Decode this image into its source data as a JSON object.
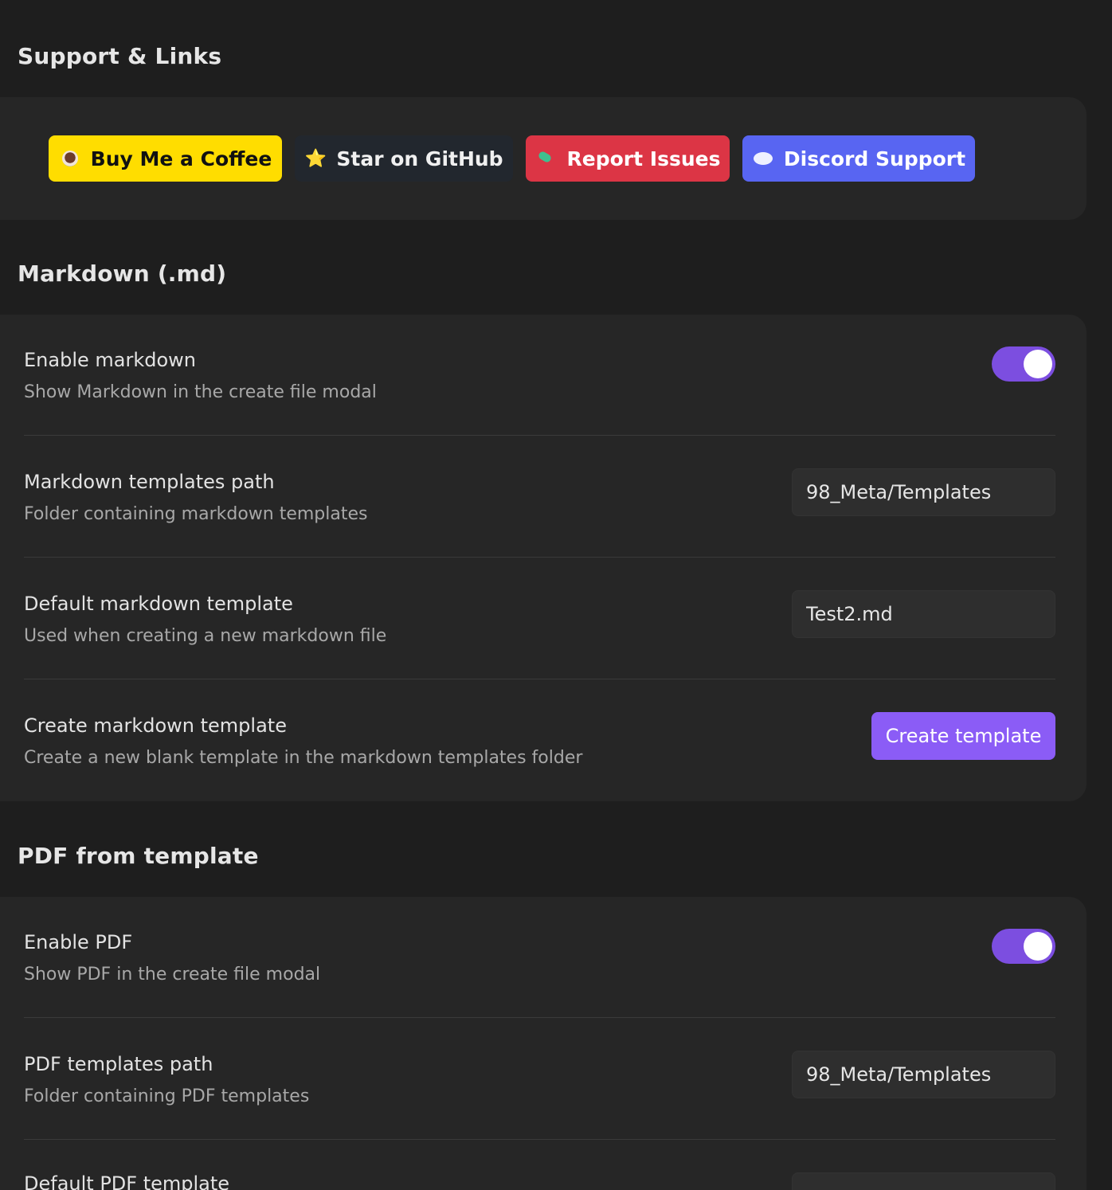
{
  "support": {
    "heading": "Support & Links",
    "buttons": {
      "coffee": {
        "label": "Buy Me a Coffee",
        "icon": "coffee-icon",
        "color": "#ffdd00"
      },
      "github": {
        "label": "Star on GitHub",
        "icon": "star-icon",
        "glyph": "⭐",
        "color": "#22272e"
      },
      "issues": {
        "label": "Report Issues",
        "icon": "bug-icon",
        "color": "#dc3545"
      },
      "discord": {
        "label": "Discord Support",
        "icon": "speech-bubble-icon",
        "color": "#5865f2"
      }
    }
  },
  "markdown": {
    "heading": "Markdown (.md)",
    "enable": {
      "name": "Enable markdown",
      "desc": "Show Markdown in the create file modal",
      "enabled": true
    },
    "templates_path": {
      "name": "Markdown templates path",
      "desc": "Folder containing markdown templates",
      "value": "98_Meta/Templates"
    },
    "default_template": {
      "name": "Default markdown template",
      "desc": "Used when creating a new markdown file",
      "value": "Test2.md"
    },
    "create_template": {
      "name": "Create markdown template",
      "desc": "Create a new blank template in the markdown templates folder",
      "button_label": "Create template"
    }
  },
  "pdf": {
    "heading": "PDF from template",
    "enable": {
      "name": "Enable PDF",
      "desc": "Show PDF in the create file modal",
      "enabled": true
    },
    "templates_path": {
      "name": "PDF templates path",
      "desc": "Folder containing PDF templates",
      "value": "98_Meta/Templates"
    },
    "default_template": {
      "name": "Default PDF template"
    }
  },
  "colors": {
    "accent": "#8b5cf6",
    "toggle_on": "#7c4ee0",
    "background": "#1e1e1e",
    "card": "#262626"
  }
}
